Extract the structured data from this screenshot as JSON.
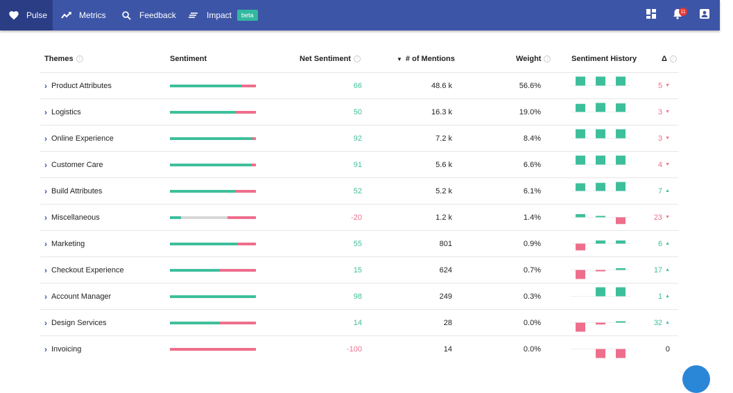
{
  "nav": {
    "items": [
      {
        "label": "Pulse",
        "icon": "heart-icon"
      },
      {
        "label": "Metrics",
        "icon": "trend-line-icon"
      },
      {
        "label": "Feedback",
        "icon": "search-icon"
      },
      {
        "label": "Impact",
        "icon": "list-lines-icon",
        "badge": "beta"
      }
    ],
    "notification_count": "11",
    "right_icons": [
      "dashboard-icon",
      "bell-icon",
      "user-icon"
    ]
  },
  "table": {
    "headers": {
      "themes": "Themes",
      "sentiment": "Sentiment",
      "net_sentiment": "Net Sentiment",
      "mentions": "# of Mentions",
      "weight": "Weight",
      "history": "Sentiment History",
      "delta": "Δ"
    },
    "sort": {
      "column": "mentions",
      "direction": "desc"
    },
    "rows": [
      {
        "theme": "Product Attributes",
        "sentiment": {
          "pos": 0.83,
          "neu": 0.0,
          "neg": 0.17
        },
        "net": "66",
        "mentions": "48.6 k",
        "weight": "56.6%",
        "history": [
          1.0,
          1.0,
          1.0
        ],
        "delta": "5",
        "delta_dir": "down"
      },
      {
        "theme": "Logistics",
        "sentiment": {
          "pos": 0.76,
          "neu": 0.0,
          "neg": 0.24
        },
        "net": "50",
        "mentions": "16.3 k",
        "weight": "19.0%",
        "history": [
          0.9,
          1.0,
          0.95
        ],
        "delta": "3",
        "delta_dir": "down"
      },
      {
        "theme": "Online Experience",
        "sentiment": {
          "pos": 0.96,
          "neu": 0.0,
          "neg": 0.04
        },
        "net": "92",
        "mentions": "7.2 k",
        "weight": "8.4%",
        "history": [
          1.0,
          1.0,
          1.0
        ],
        "delta": "3",
        "delta_dir": "down"
      },
      {
        "theme": "Customer Care",
        "sentiment": {
          "pos": 0.95,
          "neu": 0.0,
          "neg": 0.05
        },
        "net": "91",
        "mentions": "5.6 k",
        "weight": "6.6%",
        "history": [
          1.0,
          1.0,
          1.0
        ],
        "delta": "4",
        "delta_dir": "down"
      },
      {
        "theme": "Build Attributes",
        "sentiment": {
          "pos": 0.76,
          "neu": 0.0,
          "neg": 0.24
        },
        "net": "52",
        "mentions": "5.2 k",
        "weight": "6.1%",
        "history": [
          0.85,
          0.9,
          1.0
        ],
        "delta": "7",
        "delta_dir": "up"
      },
      {
        "theme": "Miscellaneous",
        "sentiment": {
          "pos": 0.13,
          "neu": 0.54,
          "neg": 0.33
        },
        "net": "-20",
        "mentions": "1.2 k",
        "weight": "1.4%",
        "history": [
          0.35,
          0.1,
          -0.75
        ],
        "delta": "23",
        "delta_dir": "down"
      },
      {
        "theme": "Marketing",
        "sentiment": {
          "pos": 0.78,
          "neu": 0.0,
          "neg": 0.22
        },
        "net": "55",
        "mentions": "801",
        "weight": "0.9%",
        "history": [
          -0.75,
          0.35,
          0.35
        ],
        "delta": "6",
        "delta_dir": "up"
      },
      {
        "theme": "Checkout Experience",
        "sentiment": {
          "pos": 0.57,
          "neu": 0.0,
          "neg": 0.43
        },
        "net": "15",
        "mentions": "624",
        "weight": "0.7%",
        "history": [
          -1.0,
          -0.05,
          0.2
        ],
        "delta": "17",
        "delta_dir": "up"
      },
      {
        "theme": "Account Manager",
        "sentiment": {
          "pos": 1.0,
          "neu": 0.0,
          "neg": 0.0
        },
        "net": "98",
        "mentions": "249",
        "weight": "0.3%",
        "history": [
          0.0,
          1.0,
          1.0
        ],
        "delta": "1",
        "delta_dir": "up"
      },
      {
        "theme": "Design Services",
        "sentiment": {
          "pos": 0.57,
          "neu": 0.0,
          "neg": 0.43
        },
        "net": "14",
        "mentions": "28",
        "weight": "0.0%",
        "history": [
          -1.0,
          -0.2,
          0.15
        ],
        "delta": "32",
        "delta_dir": "up"
      },
      {
        "theme": "Invoicing",
        "sentiment": {
          "pos": 0.0,
          "neu": 0.0,
          "neg": 1.0
        },
        "net": "-100",
        "mentions": "14",
        "weight": "0.0%",
        "history": [
          0.0,
          -1.0,
          -1.0
        ],
        "delta": "0",
        "delta_dir": "none"
      }
    ]
  },
  "colors": {
    "nav_bg": "#3d55a7",
    "positive": "#3ebf9b",
    "negative": "#ee6e8c",
    "neutral": "#d8d8d8",
    "beta_badge": "#32b8a0"
  }
}
